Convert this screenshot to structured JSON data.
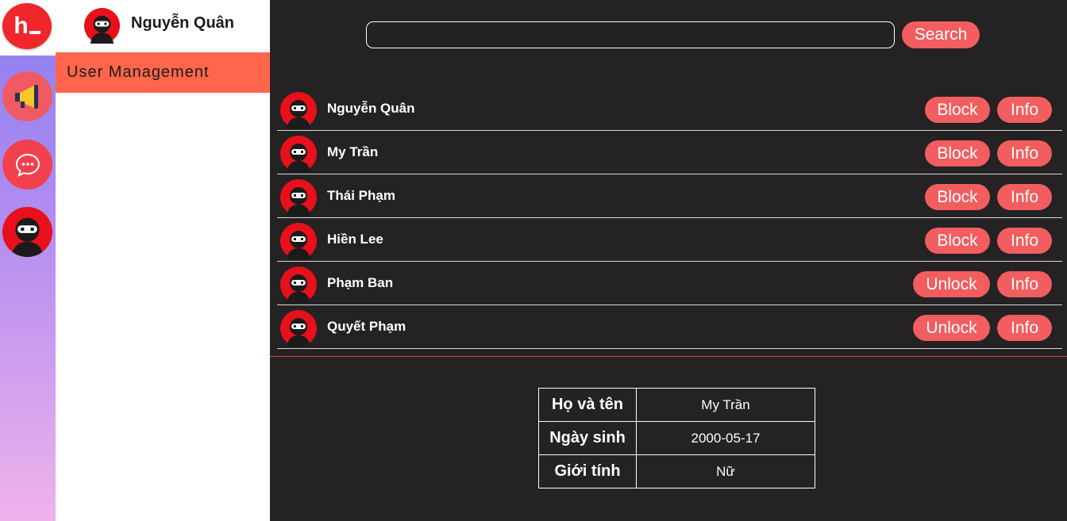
{
  "app": {
    "logo_text": "h",
    "current_user": "Nguyễn Quân"
  },
  "sidebar": {
    "menu": [
      {
        "label": "User Management",
        "active": true
      }
    ]
  },
  "search": {
    "value": "",
    "placeholder": "",
    "button_label": "Search"
  },
  "users": [
    {
      "name": "Nguyễn Quân",
      "action_label": "Block",
      "info_label": "Info"
    },
    {
      "name": "My Trần",
      "action_label": "Block",
      "info_label": "Info"
    },
    {
      "name": "Thái Phạm",
      "action_label": "Block",
      "info_label": "Info"
    },
    {
      "name": "Hiền Lee",
      "action_label": "Block",
      "info_label": "Info"
    },
    {
      "name": "Phạm Ban",
      "action_label": "Unlock",
      "info_label": "Info"
    },
    {
      "name": "Quyết Phạm",
      "action_label": "Unlock",
      "info_label": "Info"
    }
  ],
  "detail": {
    "rows": [
      {
        "key": "Họ và tên",
        "value": "My Trần"
      },
      {
        "key": "Ngày sinh",
        "value": "2000-05-17"
      },
      {
        "key": "Giới tính",
        "value": "Nữ"
      }
    ]
  },
  "colors": {
    "accent": "#f25d5f",
    "active_menu": "#ff664c",
    "background": "#242223",
    "avatar_red": "#e11"
  },
  "icons": {
    "rail": [
      "megaphone-icon",
      "chat-bubble-icon",
      "ninja-avatar-icon"
    ]
  }
}
